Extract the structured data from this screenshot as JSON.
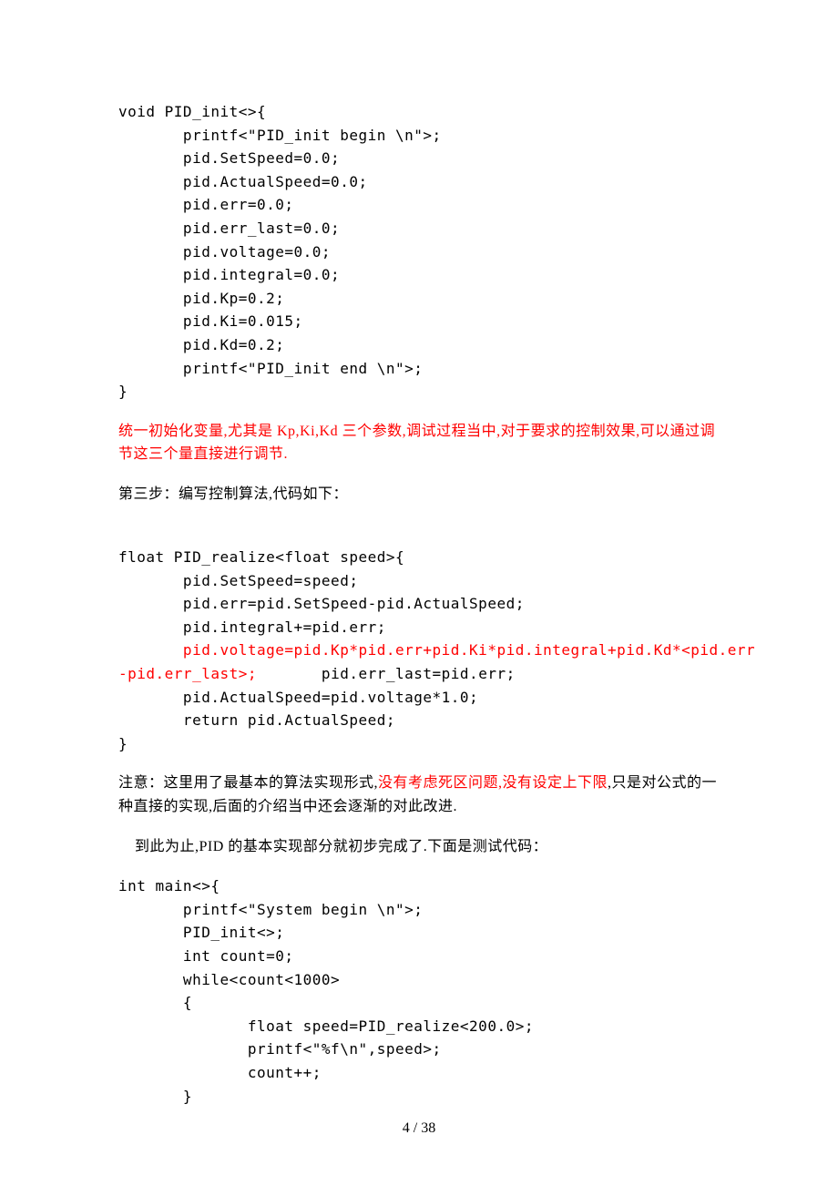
{
  "code_block1": "void PID_init<>{\n       printf<\"PID_init begin \\n\">;\n       pid.SetSpeed=0.0;\n       pid.ActualSpeed=0.0;\n       pid.err=0.0;\n       pid.err_last=0.0;\n       pid.voltage=0.0;\n       pid.integral=0.0;\n       pid.Kp=0.2;\n       pid.Ki=0.015;\n       pid.Kd=0.2;\n       printf<\"PID_init end \\n\">;\n}",
  "red_para1": "统一初始化变量,尤其是 Kp,Ki,Kd 三个参数,调试过程当中,对于要求的控制效果,可以通过调节这三个量直接进行调节.",
  "step3": "第三步：编写控制算法,代码如下：",
  "code_block2_l1": "float PID_realize<float speed>{",
  "code_block2_l2": "       pid.SetSpeed=speed;",
  "code_block2_l3": "       pid.err=pid.SetSpeed-pid.ActualSpeed;",
  "code_block2_l4": "       pid.integral+=pid.err;",
  "code_block2_red_a": "       pid.voltage=pid.Kp*pid.err+pid.Ki*pid.integral+pid.Kd*<pid.err",
  "code_block2_red_b": "-pid.err_last>;",
  "code_block2_tail": "       pid.err_last=pid.err;",
  "code_block2_l6": "       pid.ActualSpeed=pid.voltage*1.0;",
  "code_block2_l7": "       return pid.ActualSpeed;",
  "code_block2_l8": "}",
  "note_prefix": "注意：这里用了最基本的算法实现形式,",
  "note_red": "没有考虑死区问题,没有设定上下限",
  "note_suffix": ",只是对公式的一种直接的实现,后面的介绍当中还会逐渐的对此改进.",
  "para_final": "    到此为止,PID 的基本实现部分就初步完成了.下面是测试代码：",
  "code_block3": "int main<>{\n       printf<\"System begin \\n\">;\n       PID_init<>;\n       int count=0;\n       while<count<1000>\n       {\n              float speed=PID_realize<200.0>;\n              printf<\"%f\\n\",speed>;\n              count++;\n       }",
  "page_number": "4 / 38"
}
